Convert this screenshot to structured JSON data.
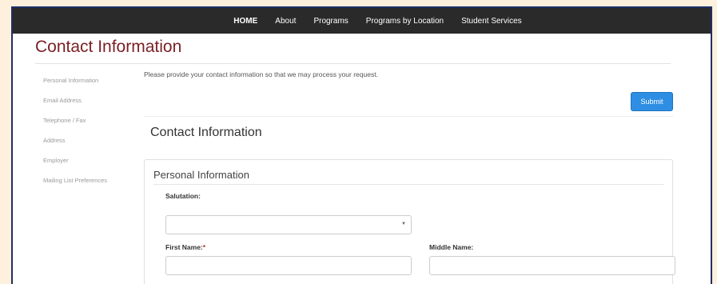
{
  "nav": {
    "items": [
      "HOME",
      "About",
      "Programs",
      "Programs by Location",
      "Student Services"
    ]
  },
  "page": {
    "title": "Contact Information",
    "intro": "Please provide your contact information so that we may process your request.",
    "submit_label": "Submit",
    "section_title": "Contact Information"
  },
  "sidebar": {
    "items": [
      "Personal Information",
      "Email Address",
      "Telephone / Fax",
      "Address",
      "Employer",
      "Mailing List Preferences"
    ]
  },
  "form": {
    "panel_title": "Personal Information",
    "salutation_label": "Salutation:",
    "salutation_value": "",
    "first_name_label": "First Name:",
    "required_mark": "*",
    "middle_name_label": "Middle Name:"
  },
  "icons": {
    "select_arrow": "chevron-down-icon"
  },
  "colors": {
    "nav_bg": "#2a2a2a",
    "title": "#7a1f24",
    "submit": "#2e8ee3",
    "required": "#c0282d",
    "outer_bg": "#fdf0dc",
    "frame_border": "#1f2f66"
  }
}
